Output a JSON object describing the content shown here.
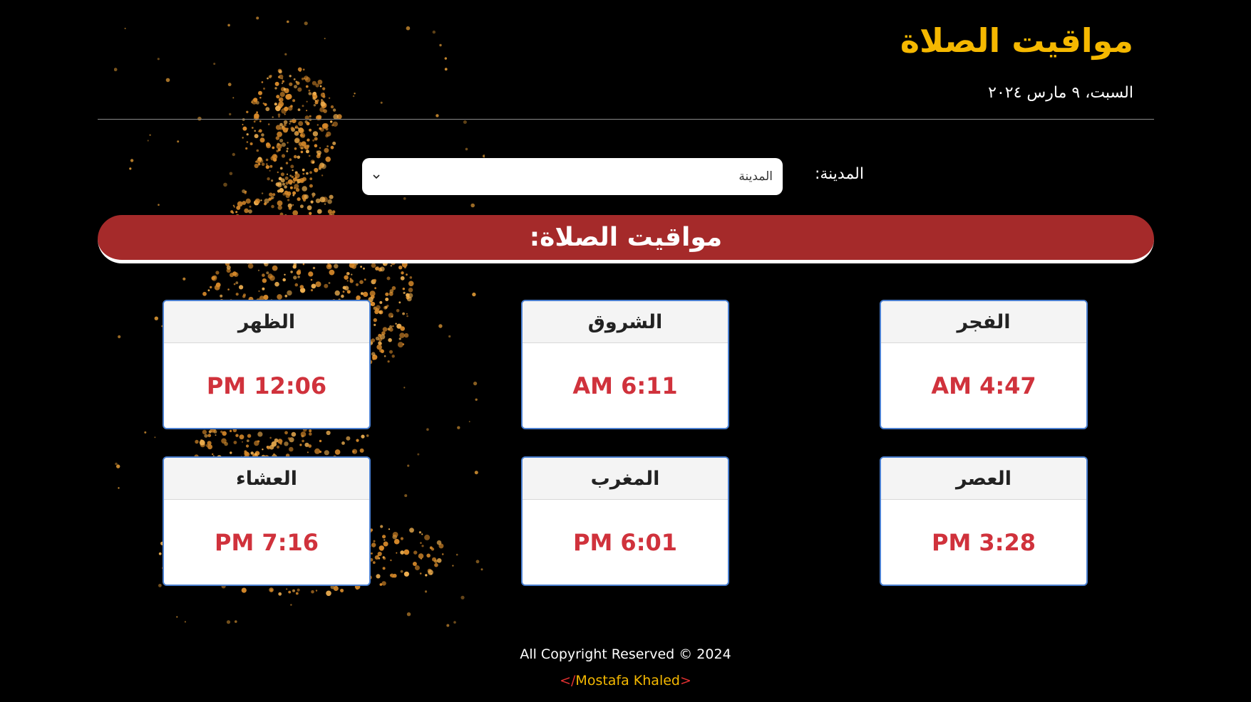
{
  "header": {
    "title": "مواقيت الصلاة",
    "date": "السبت، ٩ مارس ٢٠٢٤"
  },
  "city": {
    "label": "المدينة:",
    "selected": "المدينة"
  },
  "banner": {
    "title": "مواقيت الصلاة:"
  },
  "prayers": [
    {
      "name": "الفجر",
      "time": "AM 4:47"
    },
    {
      "name": "الشروق",
      "time": "AM 6:11"
    },
    {
      "name": "الظهر",
      "time": "PM 12:06"
    },
    {
      "name": "العصر",
      "time": "PM 3:28"
    },
    {
      "name": "المغرب",
      "time": "PM 6:01"
    },
    {
      "name": "العشاء",
      "time": "PM 7:16"
    }
  ],
  "footer": {
    "copyright": "All Copyright Reserved © 2024",
    "author_open": "</",
    "author_name": "Mostafa Khaled",
    "author_close": ">"
  },
  "colors": {
    "background": "#000000",
    "accent_gold": "#f5b800",
    "banner_red": "#a52a2a",
    "time_red": "#d0323c",
    "card_border": "#4a7fd0"
  },
  "icons": {
    "select_arrow": "chevron-down-icon",
    "background_art": "praying-figure-particles"
  }
}
